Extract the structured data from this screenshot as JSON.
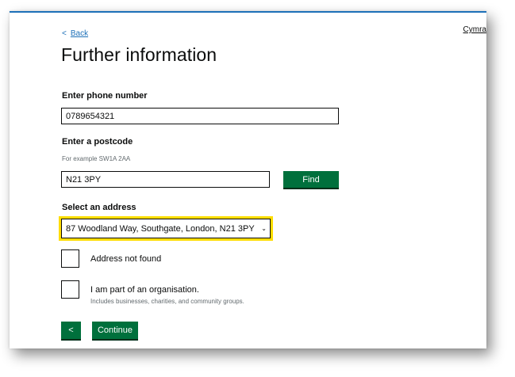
{
  "header": {
    "language_link": "Cymra"
  },
  "nav": {
    "back_label": "Back",
    "back_icon": "chevron-left-icon"
  },
  "page": {
    "title": "Further information"
  },
  "phone": {
    "label": "Enter phone number",
    "value": "0789654321"
  },
  "postcode": {
    "label": "Enter a postcode",
    "hint": "For example SW1A 2AA",
    "value": "N21 3PY",
    "find_label": "Find"
  },
  "address": {
    "label": "Select an address",
    "selected": "87 Woodland Way, Southgate, London, N21 3PY"
  },
  "options": {
    "address_not_found": "Address not found",
    "organisation": "I am part of an organisation.",
    "organisation_hint": "Includes businesses, charities, and community groups."
  },
  "actions": {
    "back_icon": "<",
    "continue_label": "Continue"
  },
  "colors": {
    "primary_green": "#00703c",
    "focus_yellow": "#ffdd00",
    "link_blue": "#1d70b8"
  }
}
